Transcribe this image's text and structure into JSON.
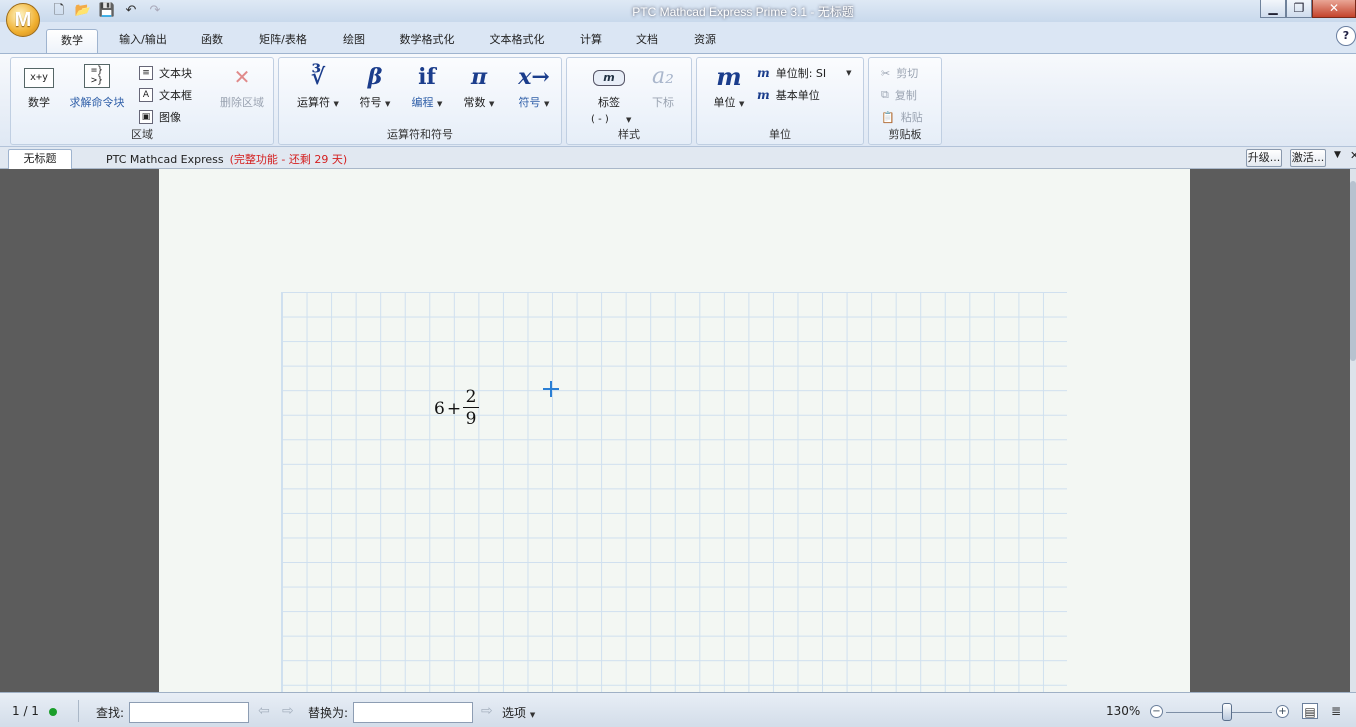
{
  "window": {
    "title": "PTC Mathcad Express Prime 3.1 - 无标题",
    "logo_letter": "M",
    "minimize": "▁",
    "maximize": "❐",
    "close": "✕"
  },
  "quick_access": {
    "icons": [
      "new-document-icon",
      "open-folder-icon",
      "save-icon",
      "undo-icon",
      "redo-icon"
    ]
  },
  "ribbon_tabs": [
    "数学",
    "输入/输出",
    "函数",
    "矩阵/表格",
    "绘图",
    "数学格式化",
    "文本格式化",
    "计算",
    "文档",
    "资源"
  ],
  "help": "?",
  "groups": {
    "regions": {
      "label": "区域",
      "math": "数学",
      "math_icon_text": "x+y",
      "solve_block": "求解命令块",
      "text_block": "文本块",
      "text_box": "文本框",
      "image": "图像",
      "delete_region": "删除区域"
    },
    "operators": {
      "label": "运算符和符号",
      "operators": "运算符",
      "symbols": "符号",
      "programming": "编程",
      "constants": "常数",
      "symbolic": "符号",
      "operators_glyph": "∛",
      "symbols_glyph": "β",
      "programming_glyph": "if",
      "constants_glyph": "π",
      "symbolic_glyph": "x→"
    },
    "style": {
      "label": "样式",
      "tag": "标签",
      "tag_value": "( - )",
      "subscript": "下标",
      "tag_glyph": "m",
      "subscript_glyph": "a₂"
    },
    "units": {
      "label": "单位",
      "units": "单位",
      "units_glyph": "m",
      "unit_system": "单位制: SI",
      "base_units": "基本单位"
    },
    "clipboard": {
      "label": "剪贴板",
      "cut": "剪切",
      "copy": "复制",
      "paste": "粘贴"
    }
  },
  "document": {
    "tab": "无标题",
    "product": "PTC Mathcad Express",
    "trial": "(完整功能 - 还剩 29 天)",
    "upgrade": "升级...",
    "activate": "激活..."
  },
  "worksheet": {
    "term1": "6",
    "operator": "+",
    "numerator": "2",
    "denominator": "9"
  },
  "status": {
    "page": "1 / 1",
    "find_label": "查找:",
    "find_value": "",
    "replace_label": "替换为:",
    "replace_value": "",
    "options": "选项",
    "zoom": "130%"
  }
}
